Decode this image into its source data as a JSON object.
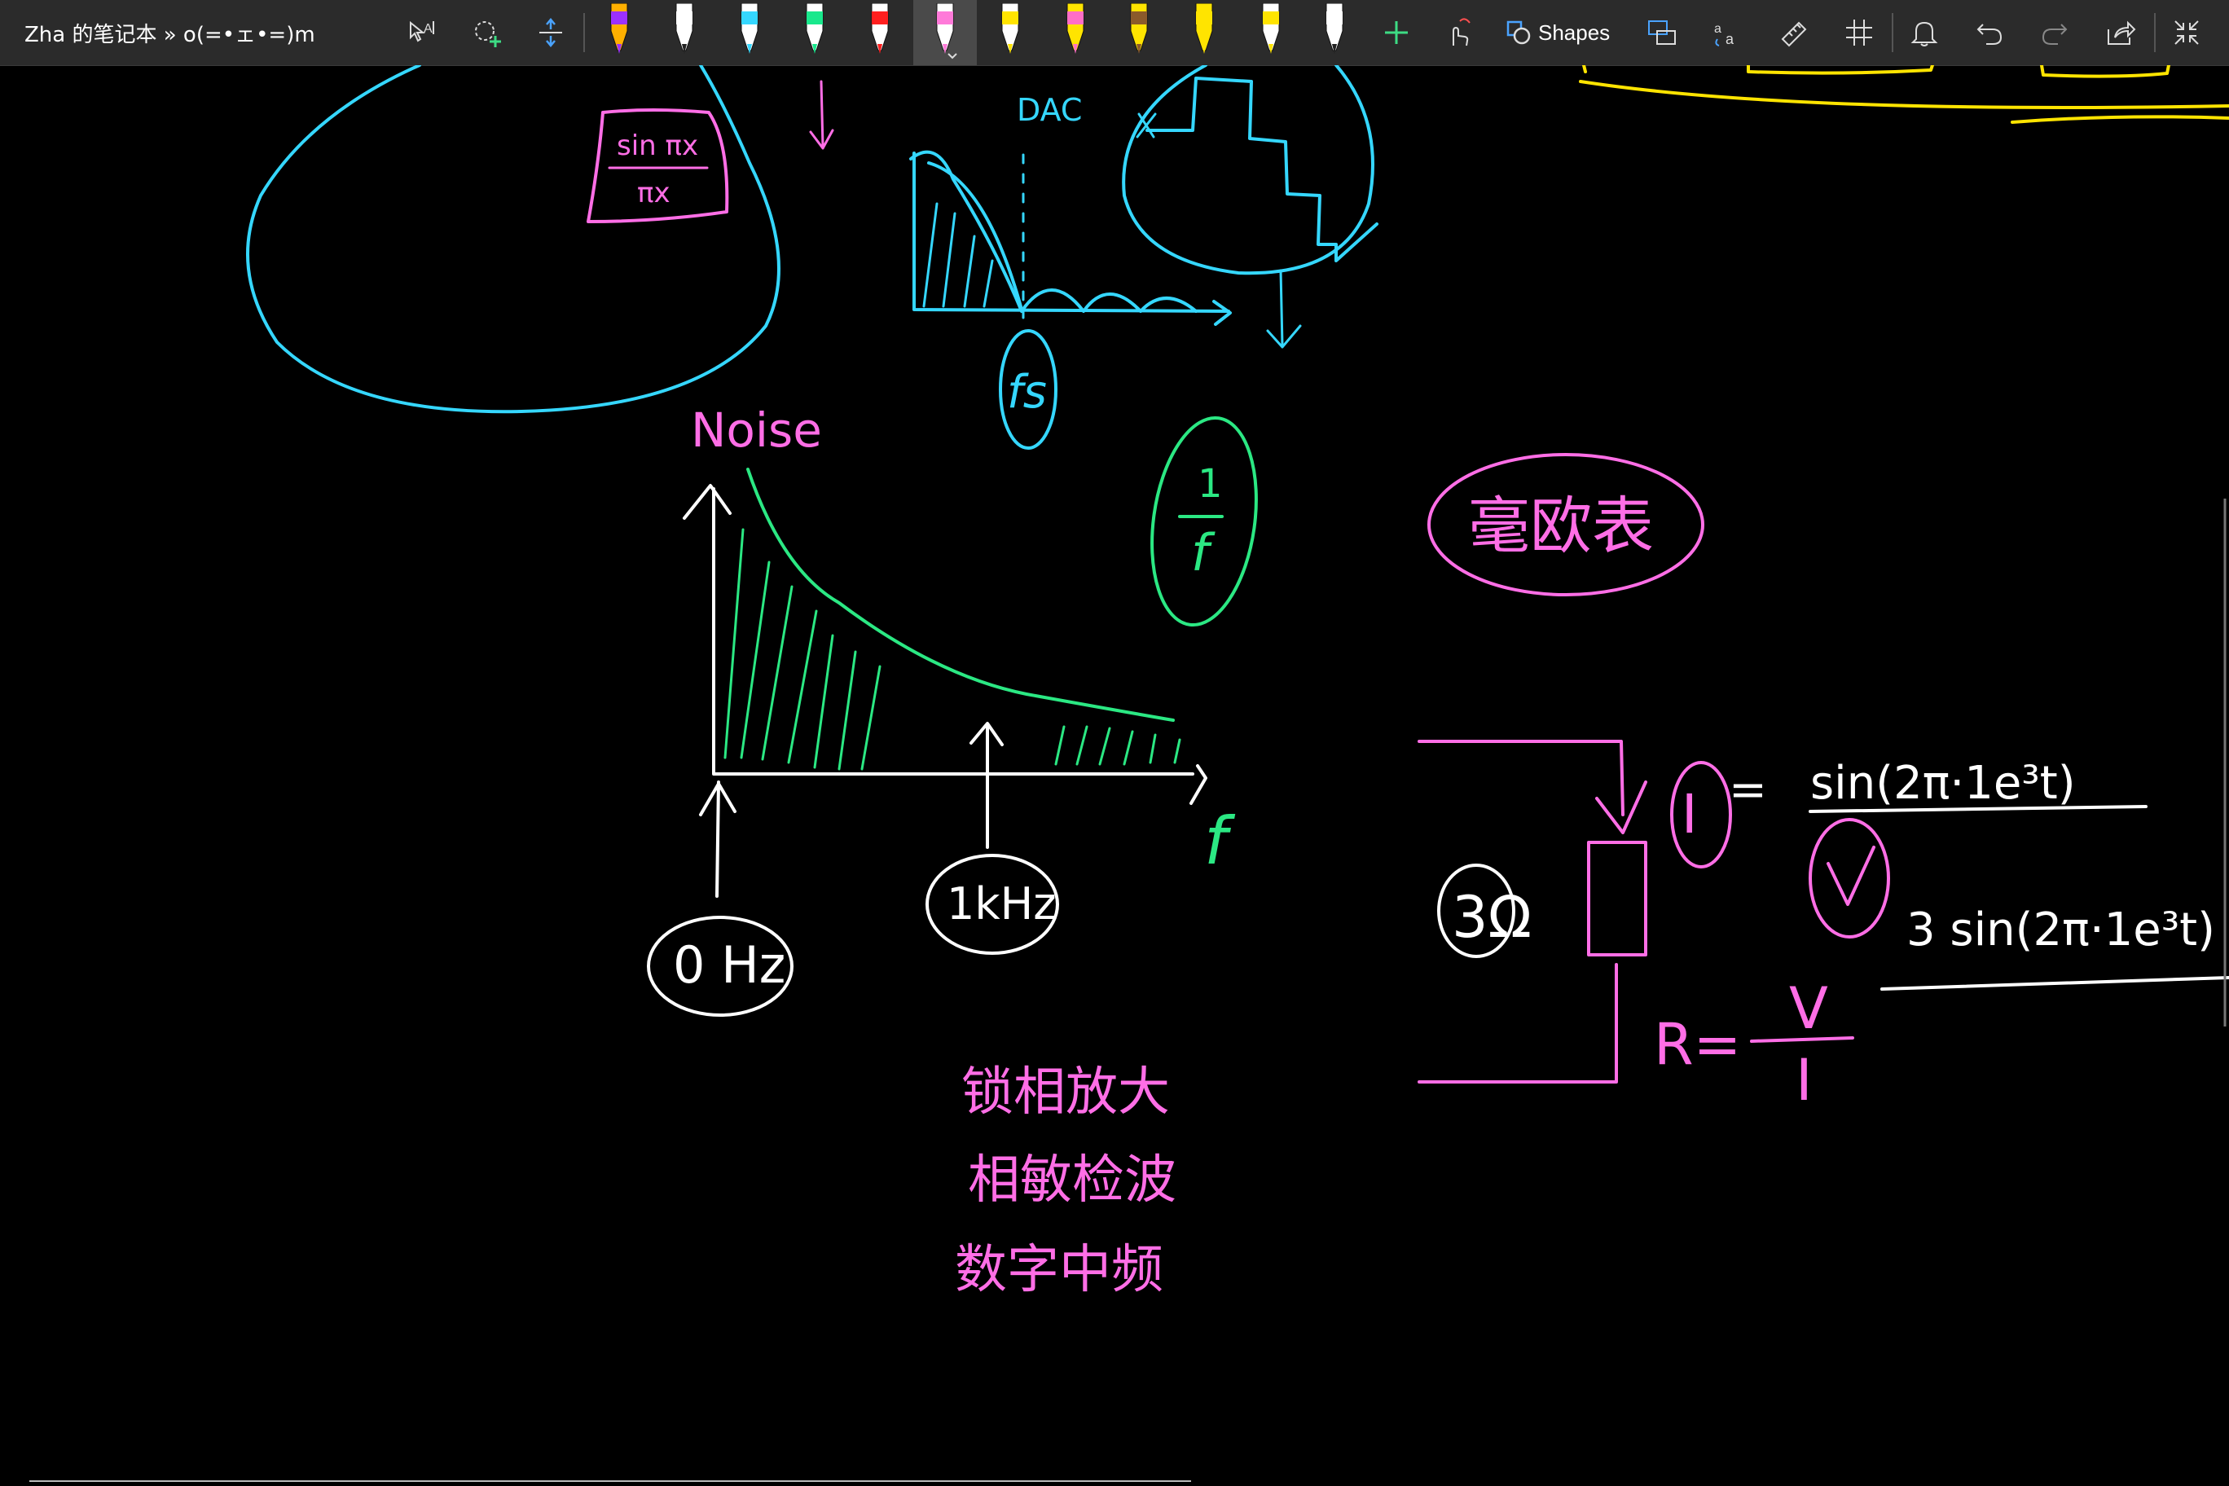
{
  "app": {
    "title": "Zha 的笔记本 » o(=•ェ•=)m"
  },
  "toolbar": {
    "tools": [
      {
        "name": "lasso-select-tool",
        "icon": "lasso-text-icon"
      },
      {
        "name": "add-space-tool",
        "icon": "lasso-plus-icon"
      },
      {
        "name": "insert-space-tool",
        "icon": "insert-space-icon"
      }
    ],
    "pens": [
      {
        "color": "#9b30ff",
        "tip": "#ffb000"
      },
      {
        "color": "#ffffff",
        "tip": "#ffffff"
      },
      {
        "color": "#35d7ff",
        "tip": "#ffffff"
      },
      {
        "color": "#19e88c",
        "tip": "#ffffff"
      },
      {
        "color": "#ff1f1f",
        "tip": "#ffffff"
      },
      {
        "color": "#ff7ad9",
        "tip": "#ffffff",
        "selected": true
      },
      {
        "color": "#ffe400",
        "tip": "#ffffff"
      },
      {
        "color": "#ff6ec7",
        "tip": "#ffe400"
      },
      {
        "color": "#8b5a2b",
        "tip": "#ffe400"
      },
      {
        "color": "#ffe400",
        "tip": "#ffe400"
      },
      {
        "color": "#ffe400",
        "tip": "#ffffff"
      },
      {
        "color": "#ffffff",
        "tip": "#ffffff"
      }
    ],
    "shapes_label": "Shapes",
    "colors": {
      "add": "#3ddc84",
      "accent": "#4aa3ff"
    }
  },
  "canvas": {
    "labels": {
      "sinc_numerator": "sin πx",
      "sinc_denominator": "πx",
      "dac": "DAC",
      "fs": "fs",
      "noise": "Noise",
      "f_axis": "f",
      "one_over_f_top": "1",
      "one_over_f_bottom": "f",
      "zero_hz": "0 Hz",
      "one_khz": "1kHz",
      "milliohm_meter": "毫欧表",
      "lockin_1": "锁相放大",
      "lockin_2": "相敏检波",
      "lockin_3": "数字中频",
      "three_ohm": "3Ω",
      "current": "I",
      "equals": "=",
      "sin_expr": "sin(2π·1e³t)",
      "three_sin_expr": "3 sin(2π·1e³t)",
      "r_eq": "R=",
      "v": "V",
      "i_denominator": "I"
    },
    "colors": {
      "cyan": "#35d7ff",
      "pink": "#ff6ee6",
      "green": "#2be883",
      "white": "#ffffff",
      "yellow": "#ffe400"
    }
  }
}
